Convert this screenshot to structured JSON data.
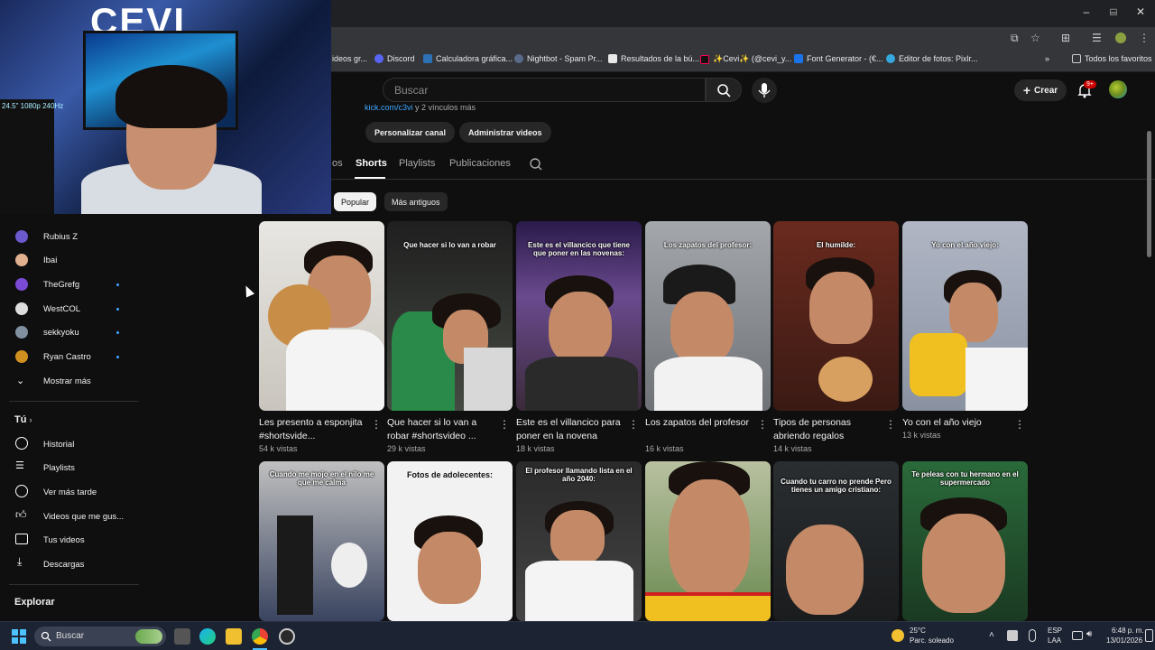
{
  "window": {
    "minimize": "–",
    "maximize": "□",
    "close": "✕"
  },
  "bookmarks": [
    {
      "label": "ideos gr...",
      "color": "#c94d4d",
      "icon": "favicon"
    },
    {
      "label": "Discord",
      "color": "#5865f2",
      "icon": "discord-icon"
    },
    {
      "label": "Calculadora gráfica...",
      "color": "#2d70b3",
      "icon": "desmos-icon"
    },
    {
      "label": "Nightbot - Spam Pr...",
      "color": "#5a6b8a",
      "icon": "nightbot-icon"
    },
    {
      "label": "Resultados de la bú...",
      "color": "#e8e8e8",
      "icon": "page-icon"
    },
    {
      "label": "✨Cevi✨ (@cevi_y...",
      "color": "#111111",
      "icon": "tiktok-icon"
    },
    {
      "label": "Font Generator - (€...",
      "color": "#1a73e8",
      "icon": "font-icon"
    },
    {
      "label": "Editor de fotos: Pixlr...",
      "color": "#36a8e0",
      "icon": "pixlr-icon"
    }
  ],
  "bookmarks_all": "Todos los favoritos",
  "header": {
    "search_placeholder": "Buscar",
    "create_label": "Crear",
    "notif_count": "9+"
  },
  "webcam": {
    "logo_text": "CEVI",
    "sign_text": "24.5\" 1080p 240Hz"
  },
  "channel": {
    "link": "kick.com/c3vi",
    "link_more": " y 2 vínculos más",
    "btn_customize": "Personalizar canal",
    "btn_manage": "Administrar videos"
  },
  "tabs": [
    {
      "label": "os",
      "active": false
    },
    {
      "label": "Shorts",
      "active": true
    },
    {
      "label": "Playlists",
      "active": false
    },
    {
      "label": "Publicaciones",
      "active": false
    }
  ],
  "chips": [
    {
      "label": "Popular",
      "active": true
    },
    {
      "label": "Más antiguos",
      "active": false
    }
  ],
  "sidebar": {
    "subscriptions": [
      {
        "label": "Rubius Z",
        "color": "#6a5acd",
        "dot": false
      },
      {
        "label": "Ibai",
        "color": "#e0b090",
        "dot": false
      },
      {
        "label": "TheGrefg",
        "color": "#7b4bd6",
        "dot": true
      },
      {
        "label": "WestCOL",
        "color": "#dddddd",
        "dot": true
      },
      {
        "label": "sekkyoku",
        "color": "#8090a0",
        "dot": true
      },
      {
        "label": "Ryan Castro",
        "color": "#d09020",
        "dot": true
      }
    ],
    "show_more": "Mostrar más",
    "you_heading": "Tú",
    "you_items": [
      {
        "label": "Historial",
        "icon": "history-icon"
      },
      {
        "label": "Playlists",
        "icon": "playlists-icon"
      },
      {
        "label": "Ver más tarde",
        "icon": "watch-later-icon"
      },
      {
        "label": "Videos que me gus...",
        "icon": "like-icon"
      },
      {
        "label": "Tus videos",
        "icon": "your-videos-icon"
      },
      {
        "label": "Descargas",
        "icon": "downloads-icon"
      }
    ],
    "explore_heading": "Explorar"
  },
  "shorts_row1": [
    {
      "title": "Les presento a esponjita #shortsvide...",
      "views": "54 k vistas",
      "caption": "",
      "bg": "#d9d6d0"
    },
    {
      "title": "Que hacer si lo van a robar  #shortsvideo ...",
      "views": "29 k vistas",
      "caption": "Que hacer si lo van a robar",
      "bg": "#3a3d38"
    },
    {
      "title": "Este es el villancico para poner en la novena",
      "views": "18 k vistas",
      "caption": "Este es el villancico que tiene que poner en las novenas:",
      "bg": "#4a3a6e"
    },
    {
      "title": "Los zapatos del profesor",
      "views": "16 k vistas",
      "caption": "Los zapatos del profesor:",
      "bg": "#8a8e92"
    },
    {
      "title": "Tipos de personas abriendo regalos",
      "views": "14 k vistas",
      "caption": "El humilde:",
      "bg": "#5a2a20"
    },
    {
      "title": "Yo con el año viejo",
      "views": "13 k vistas",
      "caption": "Yo con el año viejo:",
      "bg": "#8890a0"
    }
  ],
  "shorts_row2": [
    {
      "caption": "Cuando me mojo en el nilo me que me calma",
      "bg": "#3a4460"
    },
    {
      "caption": "Fotos de adolecentes:",
      "bg": "#f2f2f2"
    },
    {
      "caption": "El profesor llamando lista en el año 2040:",
      "bg": "#2a2a2a"
    },
    {
      "caption": "",
      "bg": "#8a9a60"
    },
    {
      "caption": "Cuando tu carro no prende Pero tienes un amigo cristiano:",
      "bg": "#2a2e30"
    },
    {
      "caption": "Te peleas con tu hermano en el supermercado",
      "bg": "#3a6a40"
    }
  ],
  "taskbar": {
    "search": "Buscar",
    "weather_temp": "25°C",
    "weather_desc": "Parc. soleado",
    "lang1": "ESP",
    "lang2": "LAA",
    "time": "6:48 p. m.",
    "date": "13/01/2026"
  }
}
